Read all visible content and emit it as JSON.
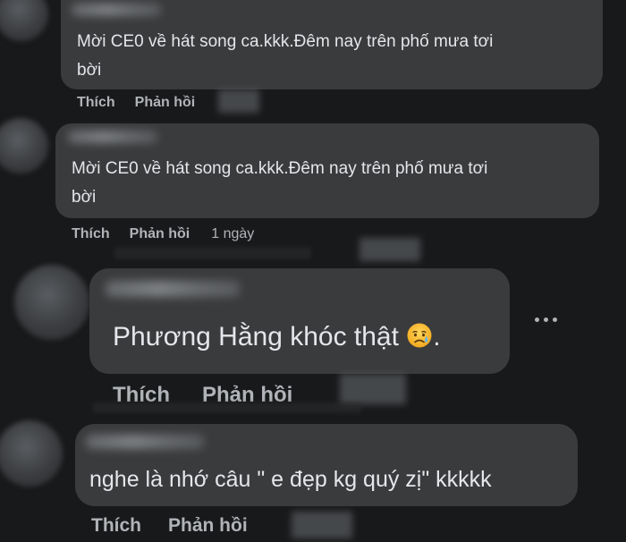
{
  "comments": [
    {
      "text_line1": "Mời CE0 về hát song ca.kkk.Đêm nay trên phố mưa tơi",
      "text_line2": "bời",
      "like_label": "Thích",
      "reply_label": "Phản hồi",
      "time": ""
    },
    {
      "text_line1": "Mời CE0 về hát song ca.kkk.Đêm nay trên phố mưa tơi",
      "text_line2": "bời",
      "like_label": "Thích",
      "reply_label": "Phản hồi",
      "time": "1 ngày"
    },
    {
      "text": "Phương Hằng khóc thật",
      "text_suffix": ".",
      "emoji": "sad-but-relieved-face",
      "like_label": "Thích",
      "reply_label": "Phản hồi",
      "time": ""
    },
    {
      "text": "nghe là nhớ câu \" e đẹp kg quý zị\" kkkkk",
      "like_label": "Thích",
      "reply_label": "Phản hồi",
      "time": ""
    }
  ],
  "colors": {
    "background": "#18191a",
    "bubble": "#3a3b3c",
    "text": "#e4e6eb",
    "secondary": "#b0b3b8"
  },
  "icons": {
    "more": "more-horizontal-icon",
    "emoji": "sad-but-relieved-face-icon"
  }
}
